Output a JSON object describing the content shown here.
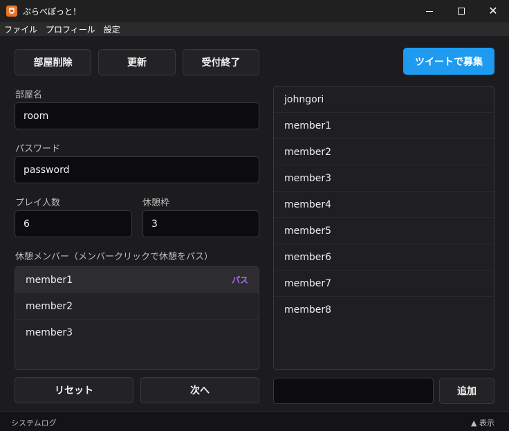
{
  "window": {
    "title": "ぷらべぽっと！",
    "minimize": "—",
    "maximize": "☐",
    "close": "✕"
  },
  "menu": [
    "ファイル",
    "プロフィール",
    "設定"
  ],
  "toolbar": {
    "delete_room": "部屋削除",
    "refresh": "更新",
    "close_reception": "受付終了",
    "tweet_recruit": "ツイートで募集"
  },
  "form": {
    "room_name_label": "部屋名",
    "room_name_value": "room",
    "password_label": "パスワード",
    "password_value": "password",
    "players_label": "プレイ人数",
    "players_value": "6",
    "break_slots_label": "休憩枠",
    "break_slots_value": "3",
    "break_members_label": "休憩メンバー（メンバークリックで休憩をパス）"
  },
  "break_members": [
    {
      "name": "member1",
      "badge": "パス"
    },
    {
      "name": "member2",
      "badge": ""
    },
    {
      "name": "member3",
      "badge": ""
    }
  ],
  "members": [
    "johngori",
    "member1",
    "member2",
    "member3",
    "member4",
    "member5",
    "member6",
    "member7",
    "member8"
  ],
  "actions": {
    "reset": "リセット",
    "next": "次へ",
    "add": "追加",
    "add_input_value": ""
  },
  "statusbar": {
    "system_log": "システムログ",
    "toggle": "▲ 表示"
  },
  "colors": {
    "accent": "#1e9bf0",
    "badge": "#a56ef5",
    "background": "#1c1c1e"
  }
}
